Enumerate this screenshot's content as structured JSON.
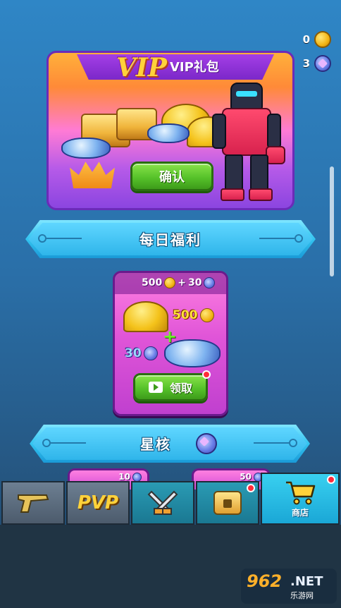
{
  "currency": {
    "coins": "0",
    "gems": "3"
  },
  "vip": {
    "logo": "VIP",
    "title": "VIP礼包",
    "confirm_label": "确认"
  },
  "daily_banner": {
    "label": "每日福利"
  },
  "daily_offer": {
    "price_coins": "500",
    "plus": "+",
    "price_gems": "30",
    "reward_coins": "500",
    "reward_plus": "+",
    "reward_gems": "30",
    "claim_label": "领取"
  },
  "star_core_banner": {
    "label": "星核"
  },
  "star_core_items": [
    {
      "price": "10"
    },
    {
      "price": "50"
    }
  ],
  "tabs": [
    {
      "name": "weapons",
      "icon": "pistol-icon"
    },
    {
      "name": "pvp",
      "label": "PVP",
      "icon": "pvp-icon"
    },
    {
      "name": "battle",
      "icon": "crossed-swords-icon"
    },
    {
      "name": "chest",
      "icon": "treasure-chest-icon"
    },
    {
      "name": "shop",
      "label": "商店",
      "icon": "shopping-cart-icon"
    }
  ],
  "watermark": {
    "big": "962",
    "net": ".NET",
    "small": "乐游网"
  },
  "colors": {
    "accent_green": "#56c22a",
    "banner_blue": "#33c4f0",
    "card_pink": "#e055d8",
    "red_dot": "#ff2a3a"
  }
}
